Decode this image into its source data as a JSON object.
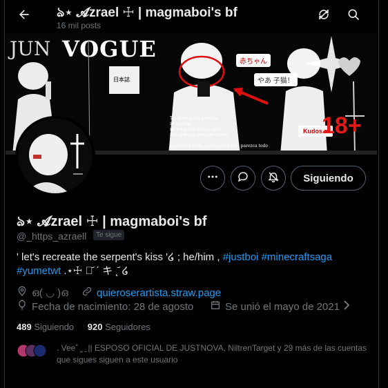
{
  "colors": {
    "accent": "#1d9bf0",
    "muted": "#71767b",
    "text": "#e7e9ea",
    "border": "#536471"
  },
  "header": {
    "title": "ঌ⋆ 𝓐zrael ☩ | magmaboi's bf",
    "post_count": "16 mil posts",
    "back_icon": "arrow-left-icon",
    "right_icons": [
      "refresh-icon",
      "search-icon"
    ]
  },
  "banner": {
    "vogue_text": "VOGUE",
    "side_text": "JUN",
    "bubble_1": "赤ちゃん",
    "bubble_2": "やあ 子猫！",
    "poem": "Te ofrezco mis poemas\nmis cartas\nmi boca que nunca calla\nmis ojos que siempre lloran\n\nte ofrezco nada, pero ojalá a ti te parezca todo",
    "kudos": "Kudos ♥",
    "age_mark": "18+"
  },
  "actions": {
    "more_icon": "more-icon",
    "message_icon": "message-icon",
    "notify_icon": "bell-icon",
    "follow_label": "Siguiendo"
  },
  "profile": {
    "display_name": "ঌ⋆ 𝓐zrael ☩ | magmaboi's bf",
    "handle": "@_https_azraell",
    "follows_you": "Te sigue",
    "bio_text": "' let's recreate the serpent's kiss '໒ ; he/him , ",
    "bio_tag_1": "#justboi",
    "bio_tag_2": "#minecraftsaga",
    "bio_tag_3": "#yumetwt",
    "bio_tail": " .⋆☩ ঌ᷄ ˊ キ ˛᷄ ໒",
    "location": "ഒ( ◡ )ഒ",
    "website": "quieroserartista.straw.page",
    "birthday": "Fecha de nacimiento: 28 de agosto",
    "joined": "Se unió el mayo de 2021"
  },
  "stats": {
    "following_count": "489",
    "following_label": "Siguiendo",
    "followers_count": "920",
    "followers_label": "Seguidores"
  },
  "followers_you_know": {
    "text": ". Vee˚ ̥˳ ̫ || ESPOSO OFICIAL DE JUSTNOVA, NiltrenTarget y 29 más de las cuentas que sigues siguen a este usuario"
  }
}
